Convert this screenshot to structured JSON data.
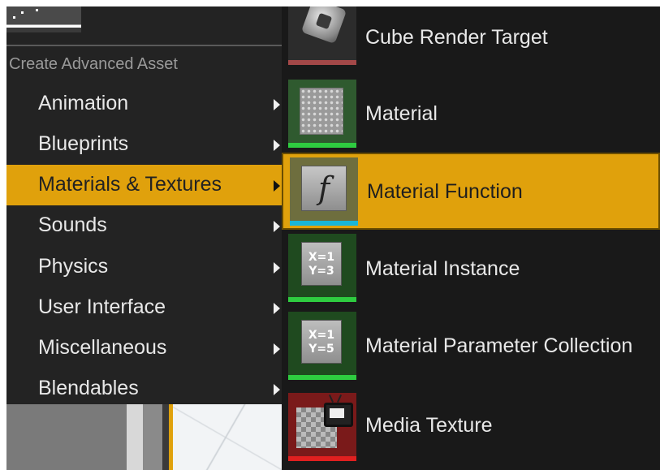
{
  "left_menu": {
    "section_header": "Create Advanced Asset",
    "items": [
      {
        "label": "Animation",
        "active": false
      },
      {
        "label": "Blueprints",
        "active": false
      },
      {
        "label": "Materials & Textures",
        "active": true
      },
      {
        "label": "Sounds",
        "active": false
      },
      {
        "label": "Physics",
        "active": false
      },
      {
        "label": "User Interface",
        "active": false
      },
      {
        "label": "Miscellaneous",
        "active": false
      },
      {
        "label": "Blendables",
        "active": false
      }
    ]
  },
  "submenu": {
    "items": [
      {
        "label": "Cube Render Target",
        "icon": "cube-render-target-icon",
        "bar_color": "#a34848"
      },
      {
        "label": "Material",
        "icon": "material-icon",
        "bar_color": "#2ecc40"
      },
      {
        "label": "Material Function",
        "icon": "material-function-icon",
        "bar_color": "#19b6d8"
      },
      {
        "label": "Material Instance",
        "icon": "material-instance-icon",
        "bar_color": "#2ecc40",
        "glyph": "X=1\nY=3"
      },
      {
        "label": "Material Parameter Collection",
        "icon": "material-parameter-collection-icon",
        "bar_color": "#2ecc40",
        "glyph": "X=1\nY=5"
      },
      {
        "label": "Media Texture",
        "icon": "media-texture-icon",
        "bar_color": "#e02020"
      }
    ],
    "function_glyph": "f"
  },
  "colors": {
    "highlight": "#e0a10c",
    "background": "#1b1b1b"
  }
}
